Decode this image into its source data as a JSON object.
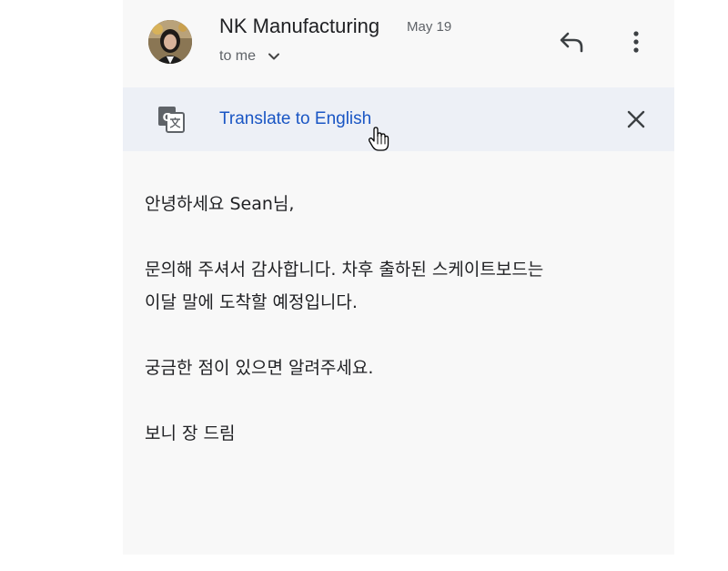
{
  "email": {
    "sender": "NK Manufacturing",
    "date": "May 19",
    "recipient": "to me",
    "icons": {
      "reply": "reply-icon",
      "more": "more-vert-icon",
      "expand": "chevron-down-icon"
    }
  },
  "translate_bar": {
    "link_label": "Translate to English",
    "icon": "google-translate-icon",
    "close": "close-icon"
  },
  "message": {
    "greeting": "안녕하세요 Sean님,",
    "paragraph1_line1": "문의해 주셔서 감사합니다. 차후 출하된 스케이트보드는",
    "paragraph1_line2": "이달 말에 도착할 예정입니다.",
    "paragraph2": "궁금한 점이 있으면 알려주세요.",
    "signoff": "보니 장 드림"
  },
  "colors": {
    "link": "#1a56c4",
    "translate_bar_bg": "#edf0f6",
    "panel_bg": "#f8f8f8",
    "text": "#202124",
    "secondary_text": "#5f6368"
  }
}
